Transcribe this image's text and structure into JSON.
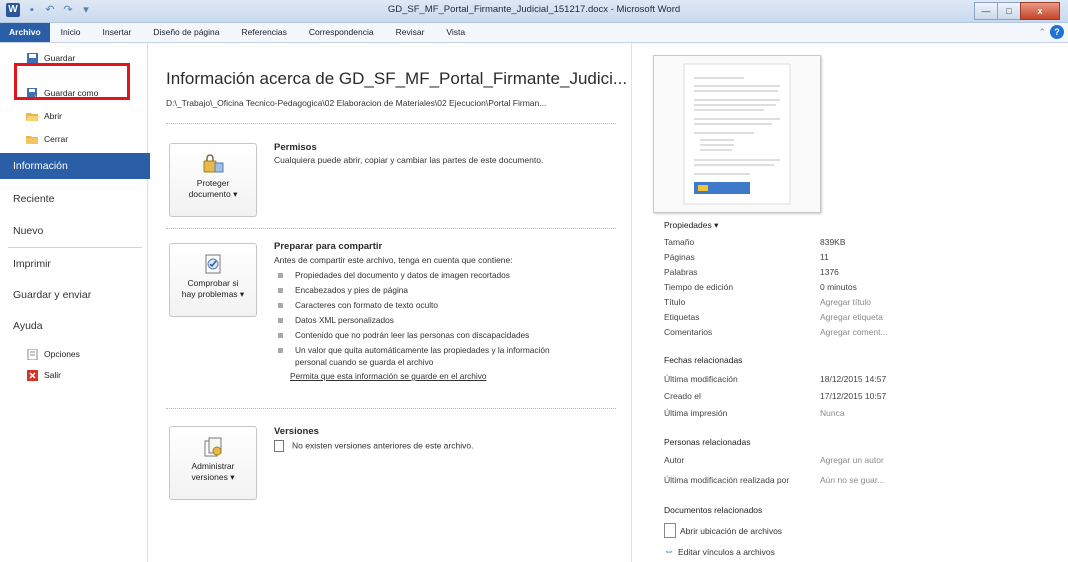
{
  "window": {
    "title": "GD_SF_MF_Portal_Firmante_Judicial_151217.docx - Microsoft Word",
    "logo": "W",
    "buttons": {
      "minimize": "—",
      "maximize": "□",
      "close": "x"
    }
  },
  "ribbon": {
    "tabs": [
      "Archivo",
      "Inicio",
      "Insertar",
      "Diseño de página",
      "Referencias",
      "Correspondencia",
      "Revisar",
      "Vista"
    ]
  },
  "sidebar": {
    "small_items": [
      {
        "label": "Guardar",
        "icon": "save-icon"
      },
      {
        "label": "Guardar como",
        "icon": "save-as-icon"
      },
      {
        "label": "Abrir",
        "icon": "open-folder-icon"
      },
      {
        "label": "Cerrar",
        "icon": "close-folder-icon"
      }
    ],
    "items": [
      "Información",
      "Reciente",
      "Nuevo",
      "Imprimir",
      "Guardar y enviar",
      "Ayuda"
    ],
    "bottom_items": [
      {
        "label": "Opciones",
        "icon": "options-icon"
      },
      {
        "label": "Salir",
        "icon": "exit-icon"
      }
    ]
  },
  "main": {
    "title": "Información acerca de GD_SF_MF_Portal_Firmante_Judici...",
    "path": "D:\\_Trabajo\\_Oficina Tecnico-Pedagogica\\02 Elaboracion de Materiales\\02 Ejecucion\\Portal Firman...",
    "permisos": {
      "button": [
        "Proteger",
        "documento ▾"
      ],
      "title": "Permisos",
      "text": "Cualquiera puede abrir, copiar y cambiar las partes de este documento."
    },
    "preparar": {
      "button": [
        "Comprobar si",
        "hay problemas ▾"
      ],
      "title": "Preparar para compartir",
      "intro": "Antes de compartir este archivo, tenga en cuenta que contiene:",
      "bullets": [
        "Propiedades del documento y datos de imagen recortados",
        "Encabezados y pies de página",
        "Caracteres con formato de texto oculto",
        "Datos XML personalizados",
        "Contenido que no podrán leer las personas con discapacidades",
        "Un valor que quita automáticamente las propiedades y la información",
        "personal cuando se guarda el archivo"
      ],
      "link": "Permita que esta información se guarde en el archivo"
    },
    "versiones": {
      "button": [
        "Administrar",
        "versiones ▾"
      ],
      "title": "Versiones",
      "text": "No existen versiones anteriores de este archivo."
    }
  },
  "right": {
    "props_title": "Propiedades ▾",
    "properties": [
      {
        "k": "Tamaño",
        "v": "839KB",
        "gray": false
      },
      {
        "k": "Páginas",
        "v": "11",
        "gray": false
      },
      {
        "k": "Palabras",
        "v": "1376",
        "gray": false
      },
      {
        "k": "Tiempo de edición",
        "v": "0 minutos",
        "gray": false
      },
      {
        "k": "Título",
        "v": "Agregar título",
        "gray": true
      },
      {
        "k": "Etiquetas",
        "v": "Agregar etiqueta",
        "gray": true
      },
      {
        "k": "Comentarios",
        "v": "Agregar coment...",
        "gray": true
      }
    ],
    "fechas_title": "Fechas relacionadas",
    "fechas": [
      {
        "k": "Última modificación",
        "v": "18/12/2015 14:57",
        "gray": false
      },
      {
        "k": "Creado el",
        "v": "17/12/2015 10:57",
        "gray": false
      },
      {
        "k": "Última impresión",
        "v": "Nunca",
        "gray": true
      }
    ],
    "personas_title": "Personas relacionadas",
    "personas": [
      {
        "k": "Autor",
        "v": "Agregar un autor",
        "gray": true
      },
      {
        "k": "Última modificación realizada por",
        "v": "Aún no se guar...",
        "gray": true
      }
    ],
    "docs_title": "Documentos relacionados",
    "docs": [
      "Abrir ubicación de archivos",
      "Editar vínculos a archivos"
    ]
  }
}
